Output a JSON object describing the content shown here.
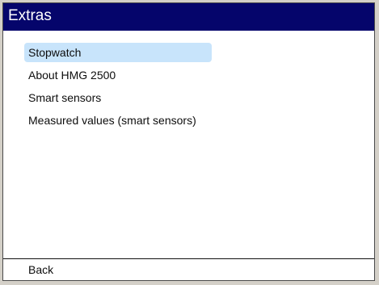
{
  "screen": {
    "title": "Extras"
  },
  "menu": {
    "items": [
      {
        "label": "Stopwatch",
        "selected": true
      },
      {
        "label": "About HMG 2500",
        "selected": false
      },
      {
        "label": "Smart sensors",
        "selected": false
      },
      {
        "label": "Measured values (smart sensors)",
        "selected": false
      }
    ]
  },
  "footer": {
    "back_label": "Back"
  },
  "colors": {
    "title_bar": "#05056b",
    "selection": "#c8e4fb",
    "background": "#ffffff"
  }
}
